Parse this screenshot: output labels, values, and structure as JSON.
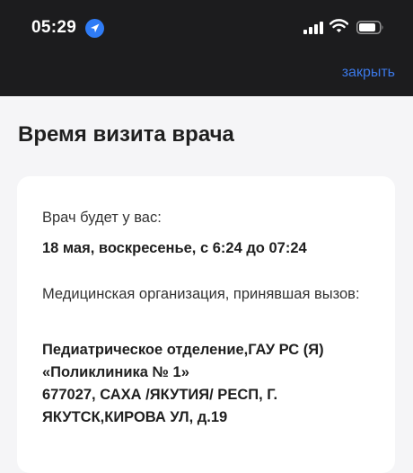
{
  "status_bar": {
    "time": "05:29",
    "icons": [
      "location-arrow-icon",
      "signal-icon",
      "wifi-icon",
      "battery-icon"
    ]
  },
  "header": {
    "close_label": "закрыть"
  },
  "page": {
    "title": "Время визита врача"
  },
  "visit": {
    "doctor_label": "Врач будет у вас:",
    "doctor_time": "18 мая, воскресенье, с 6:24 до 07:24",
    "org_label": "Медицинская организация, принявшая вызов:",
    "org_lines": [
      "Педиатрическое отделение,ГАУ РС (Я)",
      "«Поликлиника № 1»",
      "677027, САХА /ЯКУТИЯ/ РЕСП, Г.",
      "ЯКУТСК,КИРОВА УЛ, д.19"
    ]
  },
  "colors": {
    "top_bar": "#1c1c1e",
    "link": "#3b78e7",
    "location_icon": "#2f7cf6",
    "background": "#f5f5f7",
    "card": "#ffffff"
  }
}
